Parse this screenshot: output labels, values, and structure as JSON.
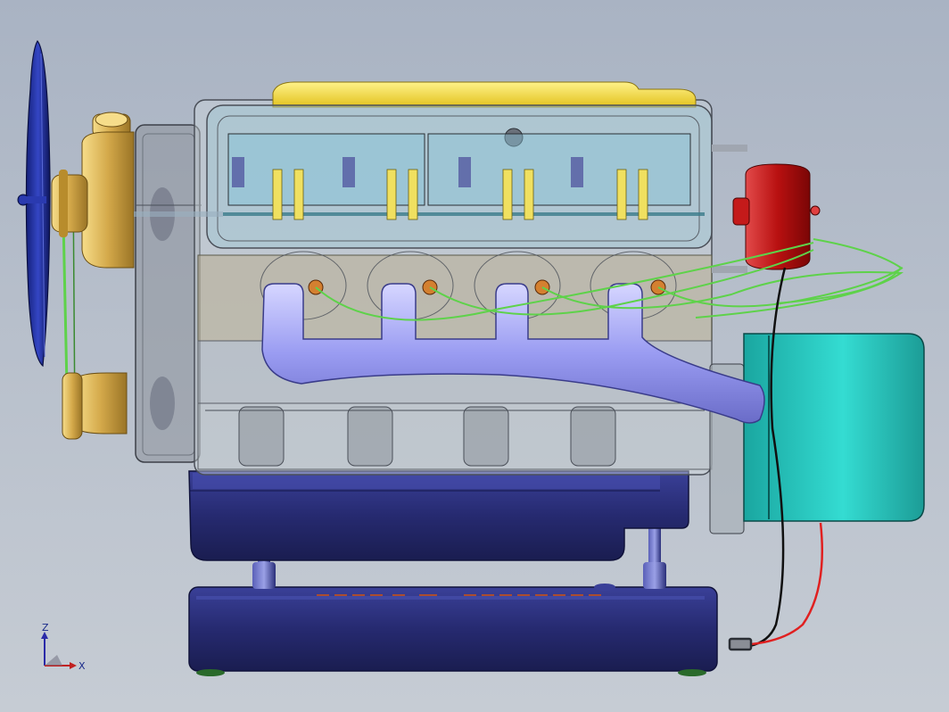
{
  "viewport": {
    "background": "#b0b8c6",
    "triad": {
      "z_label": "Z",
      "x_label": "X",
      "z_color": "#2a2aa8",
      "x_color": "#c02020"
    }
  },
  "model": {
    "parts": [
      "fan",
      "water-pump-housing",
      "lower-pulley",
      "fan-belt",
      "front-cover",
      "valve-cover",
      "transparent-engine-block",
      "cylinder-head",
      "camshaft",
      "rocker-arms",
      "spark-plugs",
      "ignition-wires",
      "intake-manifold",
      "crankcase",
      "crankshaft",
      "distributor-cap",
      "starter-motor",
      "oil-pan",
      "base-stand",
      "support-posts",
      "power-leads"
    ],
    "colors": {
      "fan": "#1e2f9a",
      "brass": "#d4a94a",
      "valve_cover": "#efd33a",
      "block_glass": "#c8d0d6",
      "block_edge": "#4a4f58",
      "manifold": "#8c8ef0",
      "distributor": "#c01818",
      "starter": "#2cc8c0",
      "base": "#2a2f7a",
      "wire": "#5ed24a",
      "lead_positive": "#e02020",
      "lead_negative": "#101010"
    }
  }
}
